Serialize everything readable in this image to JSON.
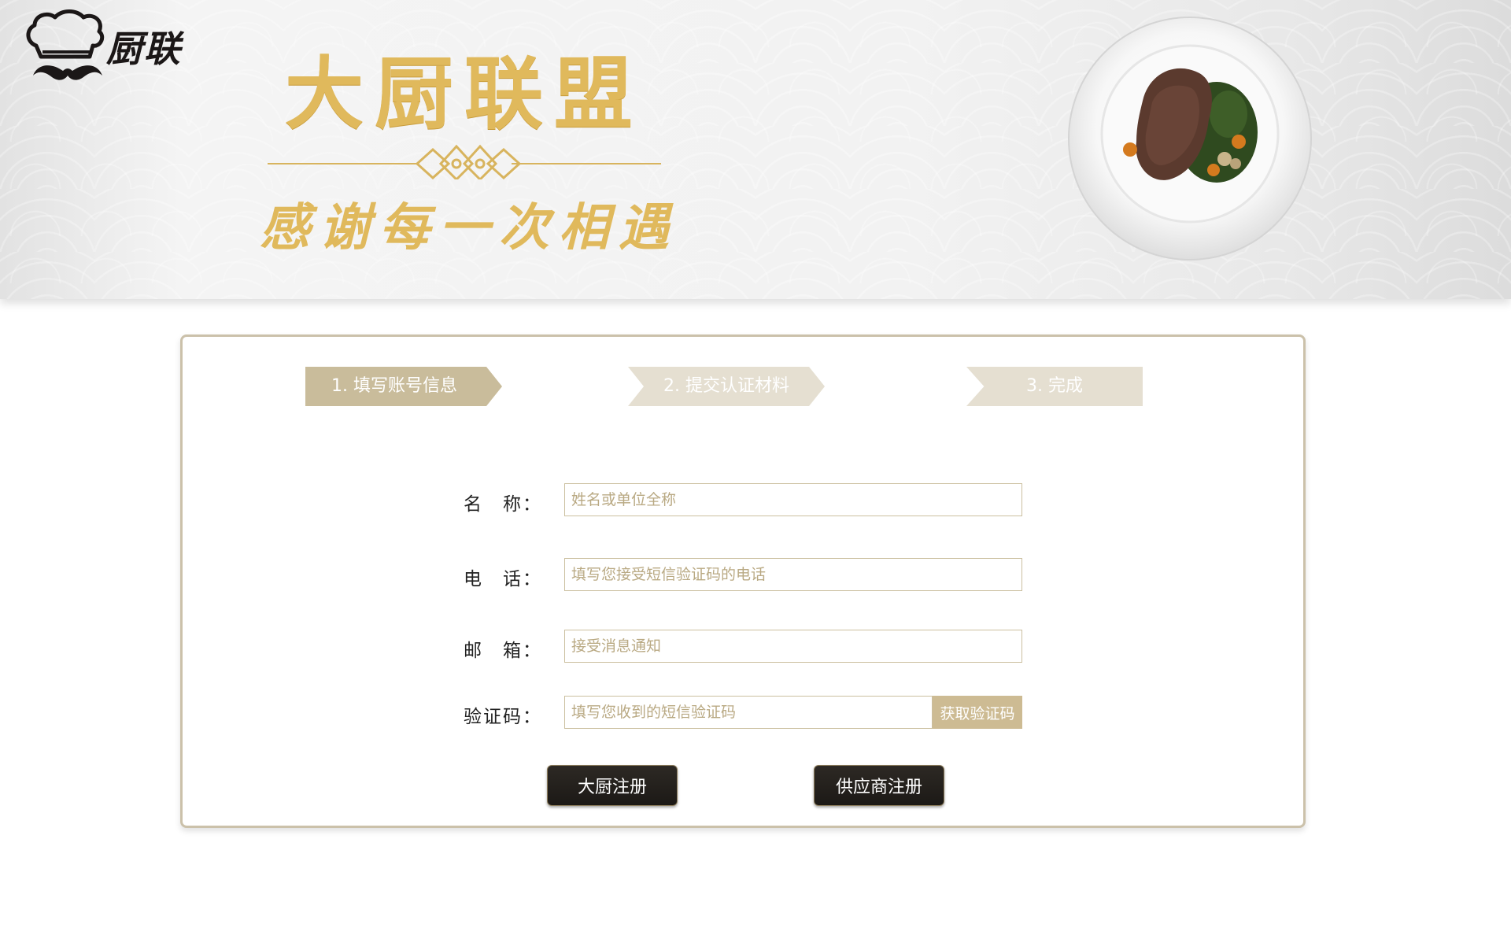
{
  "header": {
    "logo_text": "厨联",
    "title": "大厨联盟",
    "subtitle": "感谢每一次相遇"
  },
  "steps": [
    {
      "label": "1. 填写账号信息",
      "active": true
    },
    {
      "label": "2. 提交认证材料",
      "active": false
    },
    {
      "label": "3. 完成",
      "active": false
    }
  ],
  "form": {
    "name": {
      "label": "名　称：",
      "placeholder": "姓名或单位全称",
      "value": ""
    },
    "phone": {
      "label": "电　话：",
      "placeholder": "填写您接受短信验证码的电话",
      "value": ""
    },
    "email": {
      "label": "邮　箱：",
      "placeholder": "接受消息通知",
      "value": ""
    },
    "code": {
      "label": "验证码：",
      "placeholder": "填写您收到的短信验证码",
      "value": "",
      "button": "获取验证码"
    }
  },
  "actions": {
    "chef_register": "大厨注册",
    "supplier_register": "供应商注册"
  },
  "colors": {
    "accent_gold": "#e0b95c",
    "step_active": "#c9bc9b",
    "step_inactive": "#e5dfd1",
    "button_dark": "#1c1916"
  }
}
